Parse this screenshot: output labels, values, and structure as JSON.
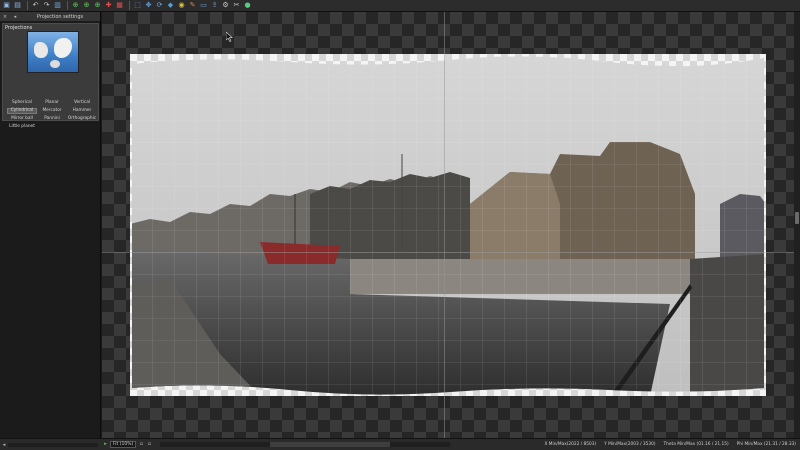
{
  "app": {
    "accent_color": "#5a5a5a"
  },
  "toolbar": {
    "icons": [
      "open-icon",
      "save-icon",
      "undo-icon",
      "redo-icon",
      "preview-icon",
      "crop-icon",
      "center-icon",
      "straighten-icon",
      "fit-icon",
      "grid-icon",
      "select-icon",
      "move-icon",
      "rotate-icon",
      "color-icon",
      "mask-icon",
      "brush-icon",
      "view-icon",
      "export-icon",
      "settings-icon",
      "tools-icon",
      "info-icon"
    ]
  },
  "panel": {
    "header_title": "Projection settings",
    "close_glyph": "×",
    "float_glyph": "◂"
  },
  "projections": {
    "title": "Projections",
    "options": [
      {
        "label": "Spherical",
        "selected": false
      },
      {
        "label": "Planar",
        "selected": false
      },
      {
        "label": "Vertical",
        "selected": false
      },
      {
        "label": "Cylindrical",
        "selected": true
      },
      {
        "label": "Mercator",
        "selected": false
      },
      {
        "label": "Hammer",
        "selected": false
      },
      {
        "label": "Mirror ball",
        "selected": false
      },
      {
        "label": "Pannini",
        "selected": false
      },
      {
        "label": "Orthographic",
        "selected": false
      },
      {
        "label": "Little planet",
        "selected": false
      }
    ]
  },
  "statusbar": {
    "zoom_value": "Fit (10%)",
    "left_glyph": "◂",
    "x_range": "X Min/Max(2022 / 8503)",
    "y_range": "Y Min/Max(2003 / 3530)",
    "theta": "Theta Min/Max (01.16 / 21.15)",
    "phi": "Phi Min/Max (21.31 / 28.33)"
  }
}
